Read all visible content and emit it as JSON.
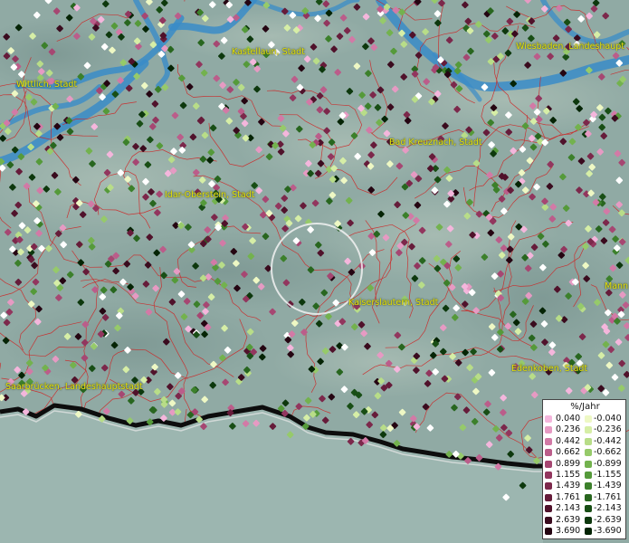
{
  "map": {
    "places": [
      {
        "name": "Wittlich, Stadt",
        "id": "wittlich"
      },
      {
        "name": "Kastellaun, Stadt",
        "id": "kastellaun"
      },
      {
        "name": "Wiesbaden, Landeshaupt",
        "id": "wiesbaden"
      },
      {
        "name": "Bad Kreuznach, Stadt",
        "id": "bad-kreuznach"
      },
      {
        "name": "Idar-Oberstein, Stadt",
        "id": "idar-oberstein"
      },
      {
        "name": "Kaiserslautern, Stadt",
        "id": "kaiserslautern"
      },
      {
        "name": "Mann",
        "id": "mannheim"
      },
      {
        "name": "Edenkoben, Stadt",
        "id": "edenkoben"
      },
      {
        "name": "Saarbrücken, Landeshauptstadt",
        "id": "saarbruecken"
      }
    ],
    "colors": {
      "terrain": "#8fa8a2",
      "water": "#3a8cc8",
      "borders": "#d02020",
      "label": "#e6e20a"
    }
  },
  "legend": {
    "title": "%/Jahr",
    "positive": [
      {
        "label": "0.040",
        "color": "#f4b6dc"
      },
      {
        "label": "0.236",
        "color": "#e69ac3"
      },
      {
        "label": "0.442",
        "color": "#d27aa6"
      },
      {
        "label": "0.662",
        "color": "#bb5d8a"
      },
      {
        "label": "0.899",
        "color": "#a64772"
      },
      {
        "label": "1.155",
        "color": "#92365e"
      },
      {
        "label": "1.439",
        "color": "#7c284b"
      },
      {
        "label": "1.761",
        "color": "#661c3a"
      },
      {
        "label": "2.143",
        "color": "#50122b"
      },
      {
        "label": "2.639",
        "color": "#3a0b1e"
      },
      {
        "label": "3.690",
        "color": "#250512"
      }
    ],
    "negative": [
      {
        "label": "-0.040",
        "color": "#eef8c4"
      },
      {
        "label": "-0.236",
        "color": "#d6eea6"
      },
      {
        "label": "-0.442",
        "color": "#b8dd88"
      },
      {
        "label": "-0.662",
        "color": "#96ca6a"
      },
      {
        "label": "-0.899",
        "color": "#73b24e"
      },
      {
        "label": "-1.155",
        "color": "#559a3a"
      },
      {
        "label": "-1.439",
        "color": "#3c802b"
      },
      {
        "label": "-1.761",
        "color": "#28661f"
      },
      {
        "label": "-2.143",
        "color": "#184e15"
      },
      {
        "label": "-2.639",
        "color": "#0d380d"
      },
      {
        "label": "-3.690",
        "color": "#052405"
      }
    ]
  }
}
